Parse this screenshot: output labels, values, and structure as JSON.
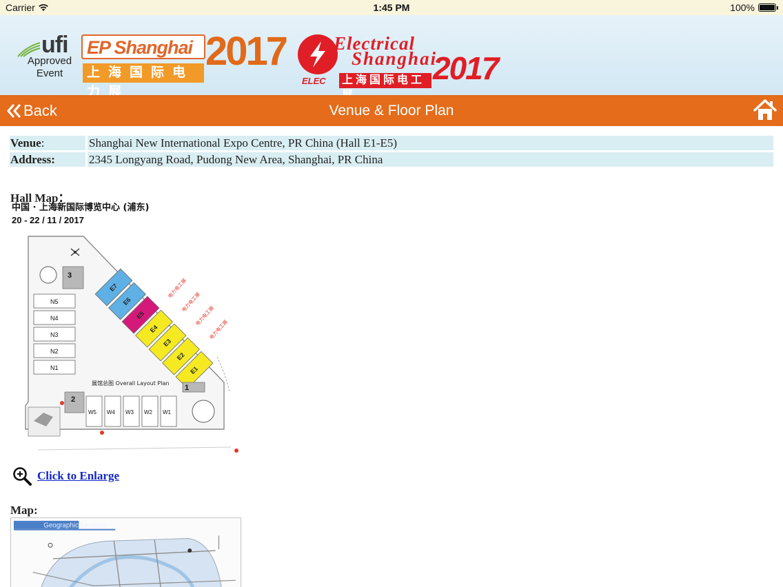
{
  "status_bar": {
    "carrier": "Carrier",
    "time": "1:45 PM",
    "battery": "100%",
    "battery_level": 1.0
  },
  "banner": {
    "ufi": {
      "brand": "ufi",
      "line1": "Approved",
      "line2": "Event"
    },
    "ep_shanghai": {
      "name": "EP Shanghai",
      "year": "2017",
      "chinese": "上海国际电力展",
      "color": "#e1662a"
    },
    "electrical_shanghai": {
      "line1": "Electrical",
      "line2": "Shanghai",
      "tag": "ELEC",
      "year": "2017",
      "chinese": "上海国际电工展",
      "color": "#e01e25"
    }
  },
  "navbar": {
    "back_label": "Back",
    "title": "Venue & Floor Plan",
    "color": "#e46c1b"
  },
  "info": {
    "venue_label": "Venue",
    "venue_colon": ":",
    "venue_value": "Shanghai New International Expo Centre, PR China (Hall E1-E5)",
    "address_label": "Address:",
    "address_value": "2345 Longyang Road, Pudong New Area, Shanghai, PR China",
    "row_color": "#d9eef2"
  },
  "hall_map": {
    "label": "Hall Map：",
    "title_cn": "中国 · 上海新国际博览中心 (浦东)",
    "dates": "20 - 22 / 11 / 2017",
    "layout_caption": "展馆总图 Overall Layout Plan",
    "north_halls": [
      "N5",
      "N4",
      "N3",
      "N2",
      "N1"
    ],
    "west_halls": [
      "W5",
      "W4",
      "W3",
      "W2",
      "W1"
    ],
    "east_halls_blue": [
      "E7",
      "E6"
    ],
    "east_hall_magenta": "E5",
    "east_halls_yellow": [
      "E4",
      "E3",
      "E2",
      "E1"
    ],
    "gates": [
      "3",
      "2",
      "1"
    ],
    "hall_colors": {
      "blue": "#5fb0e4",
      "magenta": "#d5197a",
      "yellow": "#f5ea22"
    },
    "enlarge_link": "Click to Enlarge"
  },
  "map": {
    "label": "Map:",
    "header": "Geographic Location"
  }
}
